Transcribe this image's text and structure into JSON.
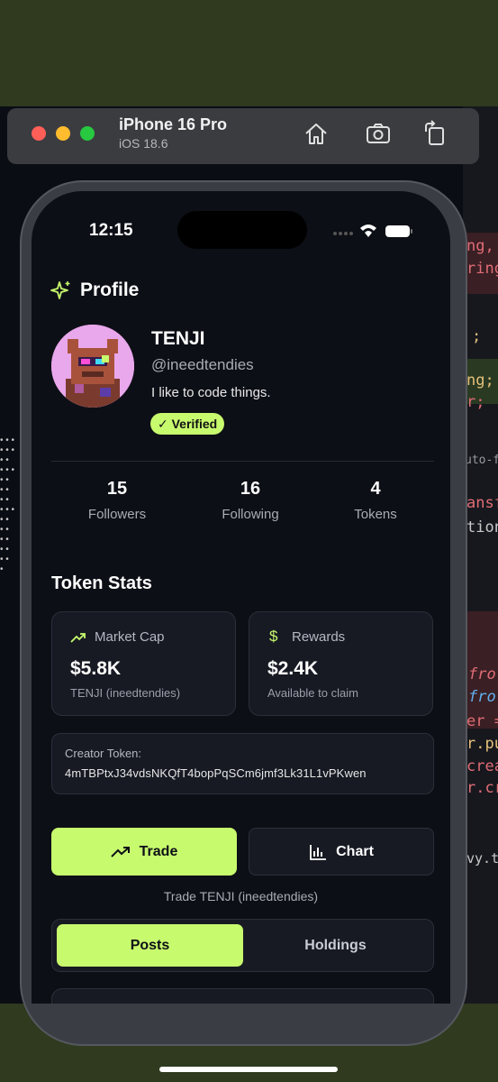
{
  "simulator": {
    "device_name": "iPhone 16 Pro",
    "os_version": "iOS 18.6",
    "icons": [
      "home-icon",
      "screenshot-icon",
      "rotate-icon"
    ]
  },
  "status_bar": {
    "time": "12:15"
  },
  "header": {
    "title": "Profile",
    "icon": "sparkles-icon"
  },
  "profile": {
    "name": "TENJI",
    "handle": "@ineedtendies",
    "bio": "I like to code things.",
    "badge": "✓ Verified"
  },
  "stats": [
    {
      "value": "15",
      "label": "Followers"
    },
    {
      "value": "16",
      "label": "Following"
    },
    {
      "value": "4",
      "label": "Tokens"
    }
  ],
  "token_stats": {
    "title": "Token Stats",
    "market_cap": {
      "label": "Market Cap",
      "value": "$5.8K",
      "sub": "TENJI (ineedtendies)"
    },
    "rewards": {
      "label": "Rewards",
      "value": "$2.4K",
      "sub": "Available to claim"
    }
  },
  "creator_token": {
    "label": "Creator Token:",
    "address": "4mTBPtxJ34vdsNKQfT4bopPqSCm6jmf3Lk31L1vPKwen"
  },
  "actions": {
    "trade_label": "Trade",
    "chart_label": "Chart",
    "trade_caption": "Trade TENJI (ineedtendies)"
  },
  "tabs": [
    {
      "label": "Posts",
      "active": true
    },
    {
      "label": "Holdings",
      "active": false
    }
  ],
  "background_code": {
    "fragments": [
      "ng,",
      "ring",
      ";",
      "ng;",
      "r;",
      "uto-f",
      "ansf",
      "tion",
      "fro",
      "fro",
      "er =",
      "r.pu",
      "crea",
      "r.cr",
      "vy.ts"
    ]
  },
  "colors": {
    "accent": "#c8fa6e",
    "screen_bg": "#0d0f16",
    "card_bg": "#171a23",
    "muted_text": "#a8acb6"
  }
}
